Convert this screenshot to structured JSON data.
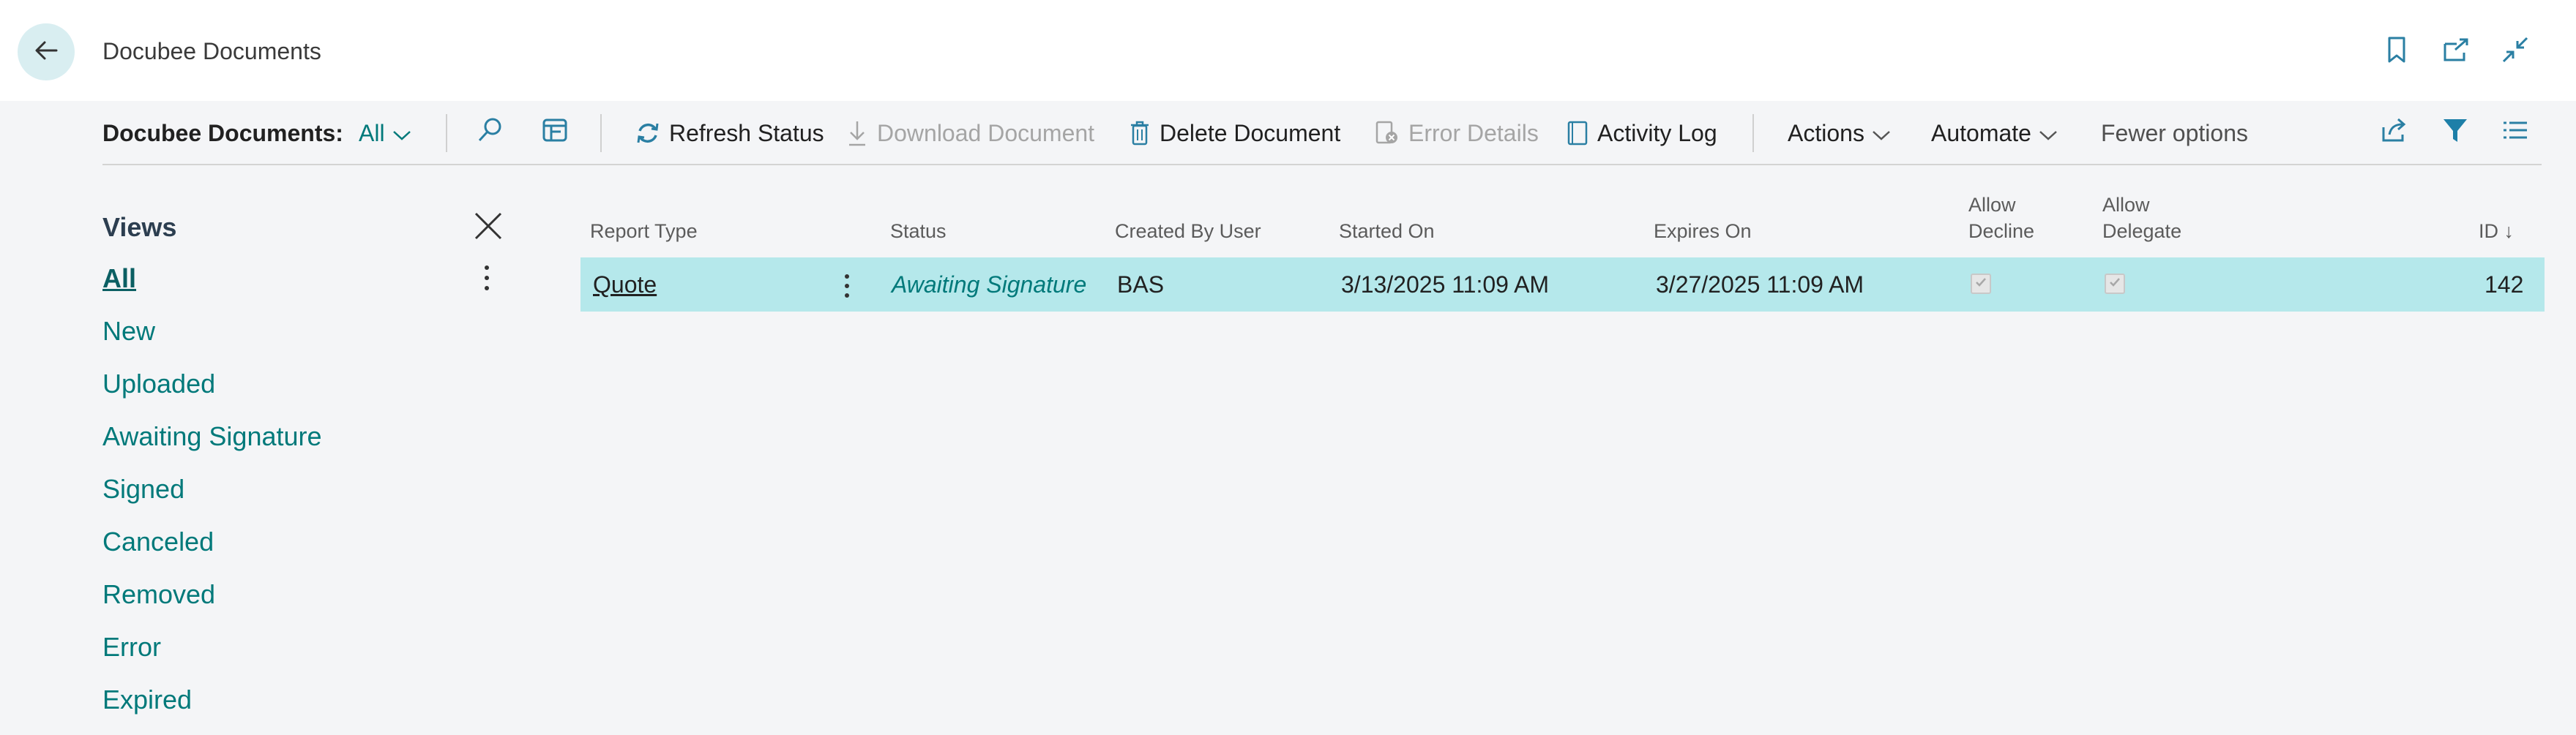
{
  "header": {
    "title": "Docubee Documents"
  },
  "toolbar": {
    "list_label": "Docubee Documents:",
    "view_selector": "All",
    "refresh_status": "Refresh Status",
    "download_document": "Download Document",
    "delete_document": "Delete Document",
    "error_details": "Error Details",
    "activity_log": "Activity Log",
    "actions": "Actions",
    "automate": "Automate",
    "fewer_options": "Fewer options"
  },
  "views": {
    "title": "Views",
    "items": [
      {
        "label": "All",
        "active": true
      },
      {
        "label": "New"
      },
      {
        "label": "Uploaded"
      },
      {
        "label": "Awaiting Signature"
      },
      {
        "label": "Signed"
      },
      {
        "label": "Canceled"
      },
      {
        "label": "Removed"
      },
      {
        "label": "Error"
      },
      {
        "label": "Expired"
      }
    ]
  },
  "table": {
    "columns": {
      "report_type": "Report Type",
      "status": "Status",
      "created_by_user": "Created By User",
      "started_on": "Started On",
      "expires_on": "Expires On",
      "allow_decline_1": "Allow",
      "allow_decline_2": "Decline",
      "allow_delegate_1": "Allow",
      "allow_delegate_2": "Delegate",
      "id": "ID"
    },
    "sort_indicator": "↓",
    "rows": [
      {
        "report_type": "Quote",
        "status": "Awaiting Signature",
        "created_by_user": "BAS",
        "started_on": "3/13/2025 11:09 AM",
        "expires_on": "3/27/2025 11:09 AM",
        "allow_decline": true,
        "allow_delegate": true,
        "id": "142"
      }
    ]
  },
  "colors": {
    "accent": "#00797a",
    "selected_row": "#b5e8eb",
    "back_button": "#d9eef1"
  }
}
